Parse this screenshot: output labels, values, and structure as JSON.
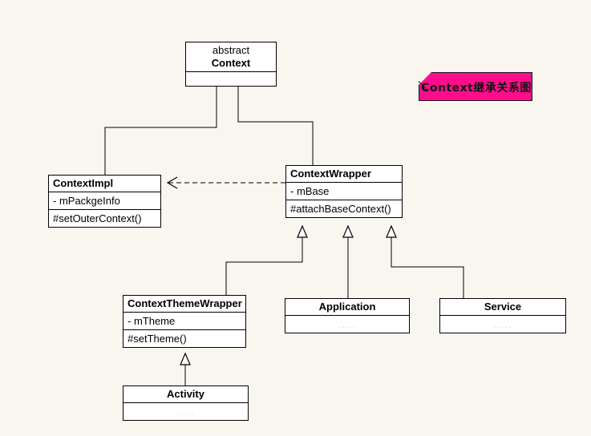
{
  "diagram": {
    "title_note": "Context继承关系图",
    "background_color": "#f9f6ef",
    "note_color": "#ff0d8c",
    "line_color": "#000000",
    "box_fill": "#ffffff"
  },
  "classes": {
    "context": {
      "stereotype": "abstract",
      "name": "Context",
      "empty_compartment": ""
    },
    "context_impl": {
      "name": "ContextImpl",
      "attribute": "- mPackgeInfo",
      "operation": "#setOuterContext()"
    },
    "context_wrapper": {
      "name": "ContextWrapper",
      "attribute": "- mBase",
      "operation": "#attachBaseContext()"
    },
    "context_theme_wrapper": {
      "name": "ContextThemeWrapper",
      "attribute": "- mTheme",
      "operation": "#setTheme()"
    },
    "application": {
      "name": "Application",
      "empty_compartment": "....."
    },
    "service": {
      "name": "Service",
      "empty_compartment": "....."
    },
    "activity": {
      "name": "Activity",
      "empty_compartment": "....."
    }
  },
  "relationships": [
    {
      "type": "generalization",
      "from": "ContextImpl",
      "to": "Context"
    },
    {
      "type": "generalization",
      "from": "ContextWrapper",
      "to": "Context"
    },
    {
      "type": "dependency",
      "from": "ContextWrapper",
      "to": "ContextImpl"
    },
    {
      "type": "generalization",
      "from": "ContextThemeWrapper",
      "to": "ContextWrapper"
    },
    {
      "type": "generalization",
      "from": "Application",
      "to": "ContextWrapper"
    },
    {
      "type": "generalization",
      "from": "Service",
      "to": "ContextWrapper"
    },
    {
      "type": "generalization",
      "from": "Activity",
      "to": "ContextThemeWrapper"
    }
  ]
}
